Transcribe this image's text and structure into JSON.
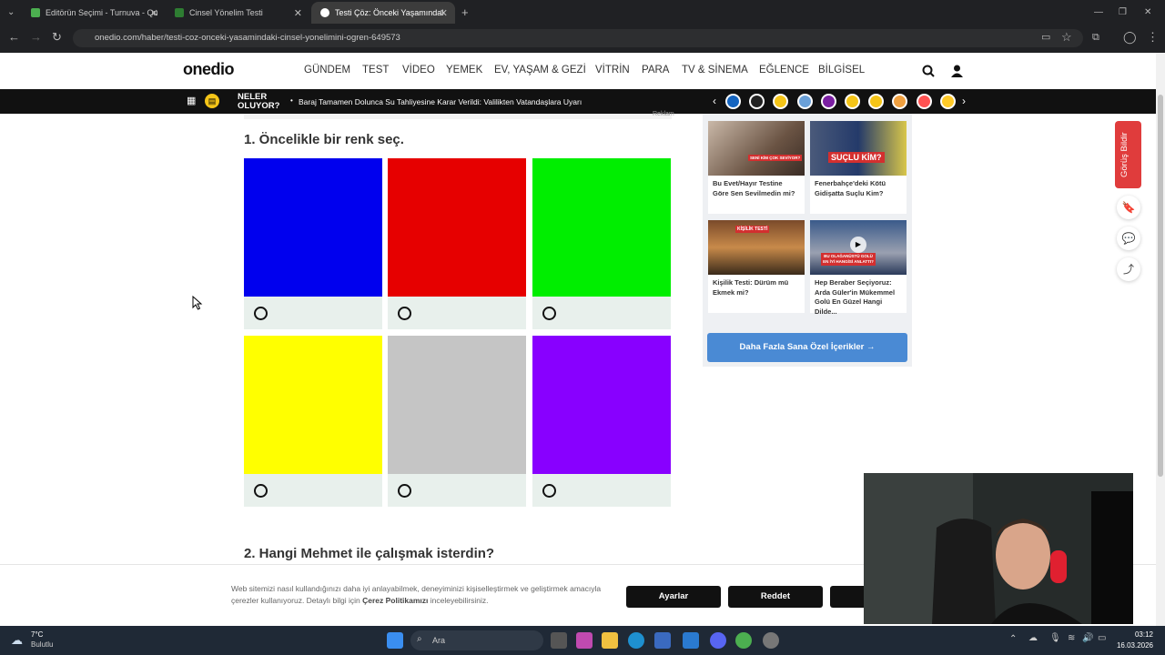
{
  "browser": {
    "tabs": [
      {
        "title": "Editörün Seçimi - Turnuva - Qu"
      },
      {
        "title": "Cinsel Yönelim Testi"
      },
      {
        "title": "Testi Çöz: Önceki Yaşamındaki C"
      }
    ],
    "url": "onedio.com/haber/testi-coz-onceki-yasamindaki-cinsel-yonelimini-ogren-649573"
  },
  "header": {
    "logo": "onedio",
    "menu": [
      "GÜNDEM",
      "TEST",
      "VİDEO",
      "YEMEK",
      "EV, YAŞAM & GEZİ",
      "VİTRİN",
      "PARA",
      "TV & SİNEMA",
      "EĞLENCE",
      "BİLGİSEL"
    ]
  },
  "newsbar": {
    "neler_1": "NELER",
    "neler_2": "OLUYOR?",
    "headline": "Baraj Tamamen Dolunca Su Tahliyesine Karar Verildi: Valilikten Vatandaşlara Uyarı",
    "story_colors": [
      "#1565c0",
      "#222222",
      "#f5c518",
      "#6aa0d8",
      "#7b1fa2",
      "#f5c518",
      "#f5c518",
      "#f0a040",
      "#ff5252",
      "#ffca28"
    ]
  },
  "content": {
    "ad_label": "Reklam",
    "q1": "1. Öncelikle bir renk seç.",
    "q2": "2. Hangi Mehmet ile çalışmak isterdin?",
    "colors": [
      "#0000ee",
      "#e60000",
      "#00ee00",
      "#ffff00",
      "#c5c5c5",
      "#8800ff"
    ]
  },
  "sidebar": {
    "cards": [
      {
        "title": "Bu Evet/Hayır Testine Göre Sen Sevilmedin mi?",
        "overlay": "SENİ KİM ÇOK SEVİYOR?"
      },
      {
        "title": "Fenerbahçe'deki Kötü Gidişatta Suçlu Kim?",
        "overlay": "SUÇLU KİM?"
      },
      {
        "title": "Kişilik Testi: Dürüm mü Ekmek mi?",
        "overlay": "KİŞİLİK TESTİ"
      },
      {
        "title": "Hep Beraber Seçiyoruz: Arda Güler'in Mükemmel Golü En Güzel Hangi Dilde...",
        "overlay": "BU OLAĞANÜSTÜ GOLÜ EN İYİ HANGİSİ ANLATTI?"
      }
    ],
    "more": "Daha Fazla Sana Özel İçerikler  →",
    "feedback": "Görüş Bildir"
  },
  "cookie": {
    "text_1": "Web sitemizi nasıl kullandığınızı daha iyi anlayabilmek, deneyiminizi kişiselleştirmek ve geliştirmek amacıyla çerezler kullanıyoruz. Detaylı bilgi için ",
    "link": "Çerez Politikamızı",
    "text_2": " inceleyebilirsiniz.",
    "settings": "Ayarlar",
    "reject": "Reddet",
    "accept_fragment": "K"
  },
  "taskbar": {
    "temp": "7°C",
    "weather": "Bulutlu",
    "search": "Ara",
    "time": "03:12",
    "date": "16.03.2026"
  }
}
